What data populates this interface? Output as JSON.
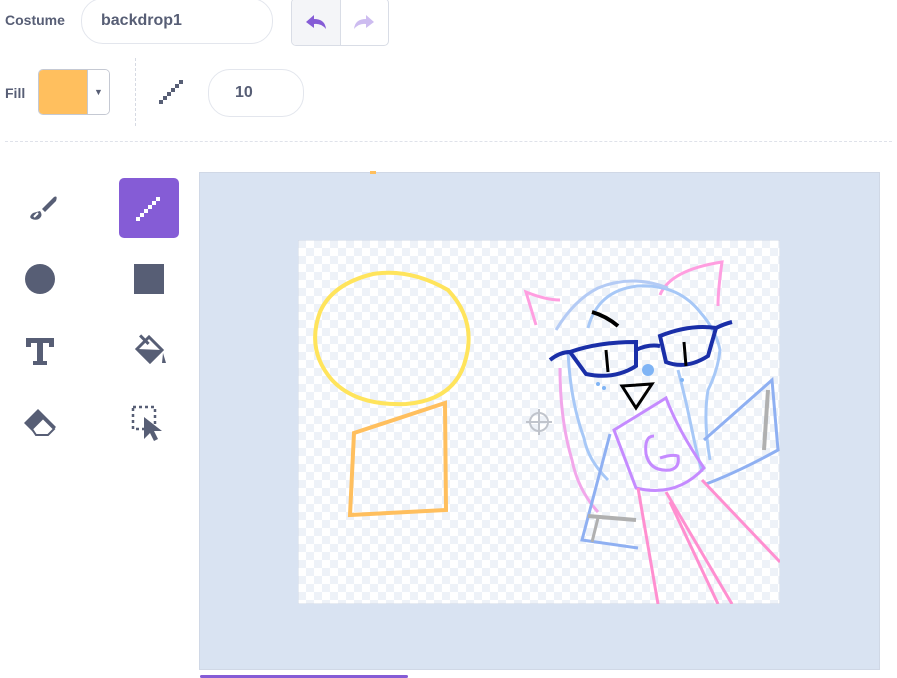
{
  "toolbar": {
    "costume_label": "Costume",
    "costume_name": "backdrop1",
    "fill_label": "Fill",
    "fill_color": "#ffbf5e",
    "line_width": "10"
  },
  "tools": [
    {
      "name": "brush",
      "icon": "brush-icon",
      "selected": false
    },
    {
      "name": "line",
      "icon": "line-icon",
      "selected": true
    },
    {
      "name": "circle",
      "icon": "circle-icon",
      "selected": false
    },
    {
      "name": "rectangle",
      "icon": "rectangle-icon",
      "selected": false
    },
    {
      "name": "text",
      "icon": "text-icon",
      "selected": false
    },
    {
      "name": "fill",
      "icon": "fill-bucket-icon",
      "selected": false
    },
    {
      "name": "eraser",
      "icon": "eraser-icon",
      "selected": false
    },
    {
      "name": "select",
      "icon": "select-icon",
      "selected": false
    }
  ],
  "colors": {
    "accent": "#855cd6",
    "stage_bg": "#d9e3f2",
    "text": "#575e75"
  }
}
